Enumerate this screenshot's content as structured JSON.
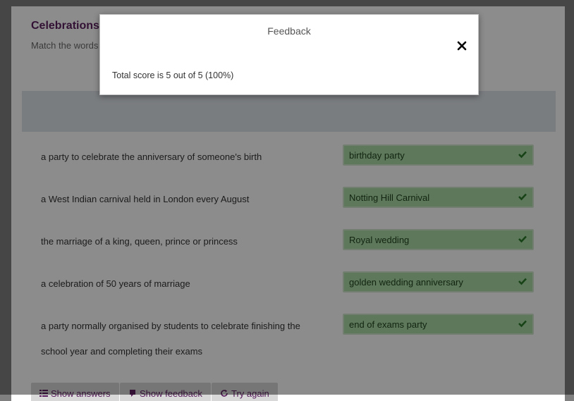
{
  "page": {
    "title": "Celebrations: words",
    "subtitle": "Match the words to the definitions."
  },
  "questions": [
    {
      "prompt": "a party to celebrate the anniversary of someone's birth",
      "answer": "birthday party",
      "status": "correct"
    },
    {
      "prompt": "a West Indian carnival held in London every August",
      "answer": "Notting Hill Carnival",
      "status": "correct"
    },
    {
      "prompt": "the marriage of a king, queen, prince or princess",
      "answer": "Royal wedding",
      "status": "correct"
    },
    {
      "prompt": "a celebration of 50 years of marriage",
      "answer": "golden wedding anniversary",
      "status": "correct"
    },
    {
      "prompt": "a party normally organised by students to celebrate finishing the school year and completing their exams",
      "answer": "end of exams party",
      "status": "correct"
    }
  ],
  "buttons": {
    "show_answers": "Show answers",
    "show_feedback": "Show feedback",
    "try_again": "Try again"
  },
  "modal": {
    "title": "Feedback",
    "close_icon": "close-icon",
    "score_text": "Total score is 5 out of 5 (100%)"
  },
  "colors": {
    "title": "#5b1f5f",
    "correct_bg": "#a9dba6",
    "check": "#2d7a2b"
  }
}
